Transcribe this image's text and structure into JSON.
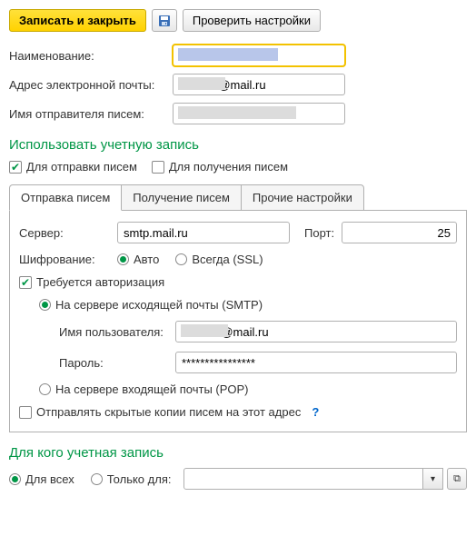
{
  "toolbar": {
    "save_close": "Записать и закрыть",
    "check_settings": "Проверить настройки"
  },
  "fields": {
    "name_label": "Наименование:",
    "name_value": "",
    "email_label": "Адрес электронной почты:",
    "email_value": "            @mail.ru",
    "sender_label": "Имя отправителя писем:",
    "sender_value": ""
  },
  "use_section": {
    "title": "Использовать учетную запись",
    "send": "Для отправки писем",
    "receive": "Для получения писем"
  },
  "tabs": {
    "send": "Отправка писем",
    "receive": "Получение писем",
    "other": "Прочие настройки"
  },
  "send_tab": {
    "server_label": "Сервер:",
    "server_value": "smtp.mail.ru",
    "port_label": "Порт:",
    "port_value": "25",
    "encryption_label": "Шифрование:",
    "enc_auto": "Авто",
    "enc_ssl": "Всегда (SSL)",
    "auth_required": "Требуется авторизация",
    "auth_smtp": "На сервере исходящей почты (SMTP)",
    "user_label": "Имя пользователя:",
    "user_value": "            @mail.ru",
    "pass_label": "Пароль:",
    "pass_value": "****************",
    "auth_pop": "На сервере входящей почты (POP)",
    "bcc": "Отправлять скрытые копии писем на этот адрес",
    "bcc_help": "?"
  },
  "whom": {
    "title": "Для кого учетная запись",
    "all": "Для всех",
    "only": "Только для:"
  }
}
